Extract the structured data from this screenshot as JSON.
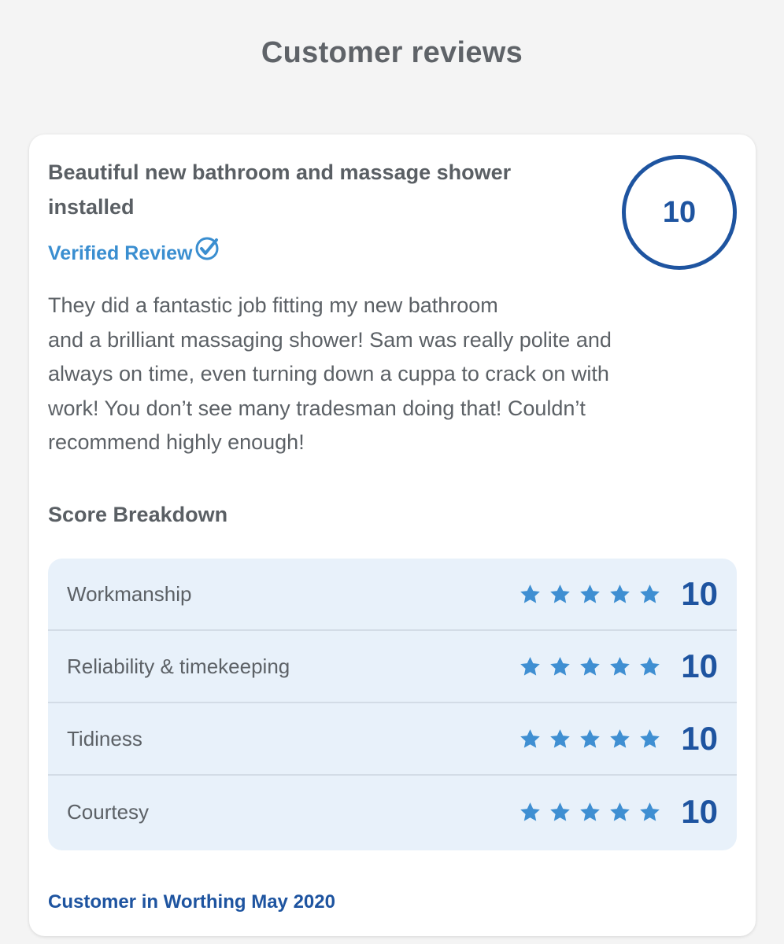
{
  "page": {
    "title": "Customer reviews"
  },
  "review": {
    "title": "Beautiful new bathroom and massage shower installed",
    "score": "10",
    "verified_label": "Verified Review",
    "verified_icon": "check-badge-icon",
    "body": "They did a fantastic job fitting my new bathroom\nand a brilliant massaging shower! Sam was really polite and\nalways on time, even turning down a cuppa to crack on with\nwork! You don’t see many tradesman doing that! Couldn’t\nrecommend highly enough!",
    "breakdown_title": "Score Breakdown",
    "breakdown": [
      {
        "label": "Workmanship",
        "stars": 5,
        "score": "10"
      },
      {
        "label": "Reliability & timekeeping",
        "stars": 5,
        "score": "10"
      },
      {
        "label": "Tidiness",
        "stars": 5,
        "score": "10"
      },
      {
        "label": "Courtesy",
        "stars": 5,
        "score": "10"
      }
    ],
    "author": "Customer in Worthing May 2020"
  },
  "colors": {
    "brand_blue": "#1e54a0",
    "accent_blue": "#3a8ed0",
    "star_blue": "#3f8fd2",
    "panel_bg": "#e8f1fa",
    "page_bg": "#f4f4f4"
  }
}
